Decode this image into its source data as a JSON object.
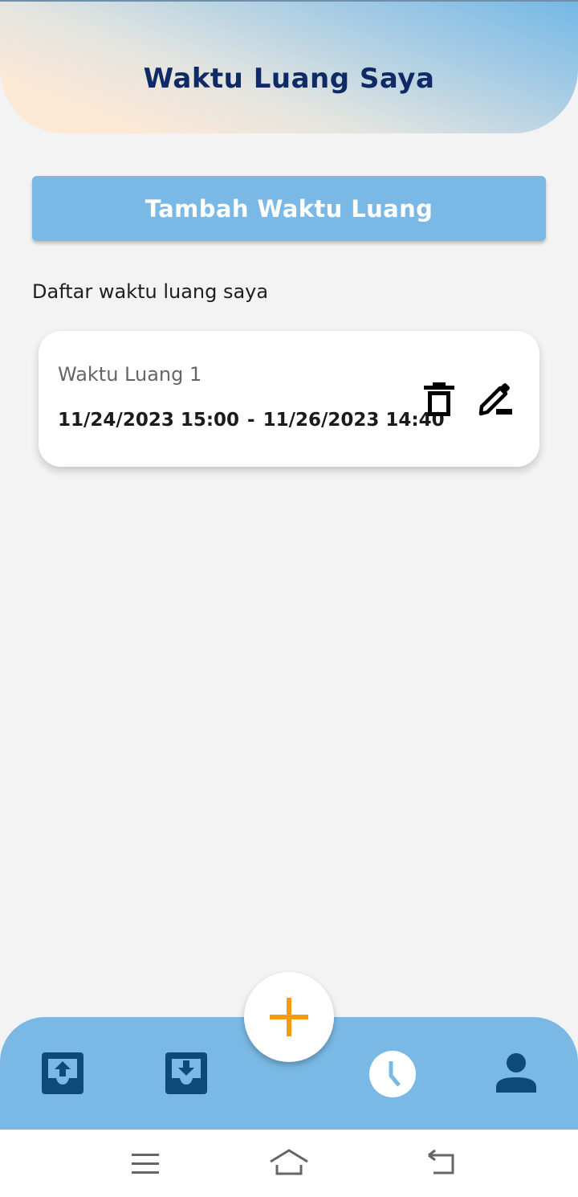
{
  "header": {
    "title": "Waktu Luang Saya"
  },
  "actions": {
    "add_label": "Tambah Waktu Luang"
  },
  "list": {
    "label": "Daftar waktu luang saya",
    "items": [
      {
        "title": "Waktu Luang 1",
        "start": "11/24/2023 15:00",
        "separator": "-",
        "end": "11/26/2023 14:40",
        "icons": [
          "trash-icon",
          "edit-icon"
        ]
      }
    ]
  },
  "bottom_nav": {
    "items": [
      "upload-inbox-icon",
      "download-inbox-icon",
      "clock-icon",
      "person-icon"
    ],
    "active": "clock-icon"
  },
  "fab": {
    "icon": "plus-icon"
  },
  "colors": {
    "accent": "#7ab9e5",
    "title": "#102a66",
    "nav_icon": "#0d4a78",
    "fab_icon": "#f39c12"
  }
}
